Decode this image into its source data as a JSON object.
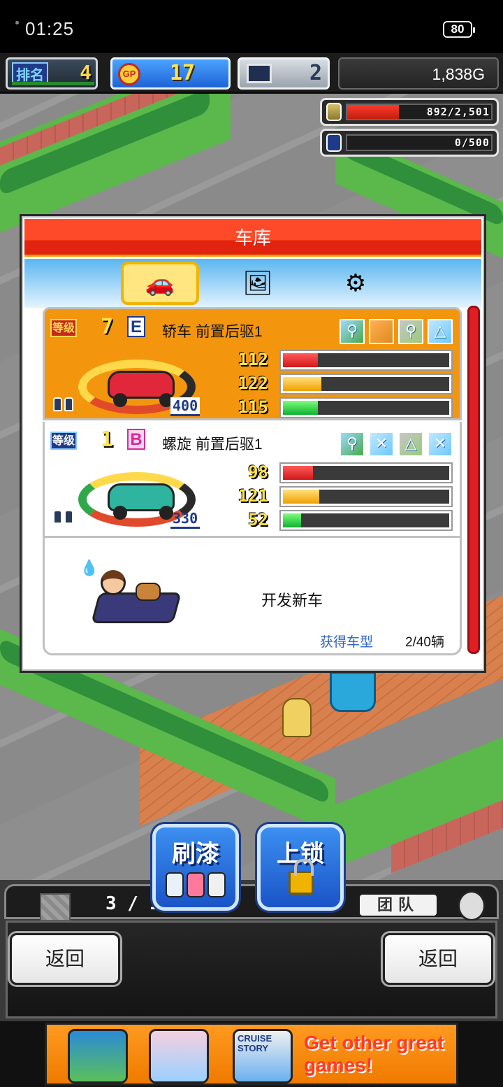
{
  "status_bar": {
    "time": "01:25",
    "battery": "80"
  },
  "hud": {
    "rank_label": "排名",
    "rank_value": "4",
    "gp_icon": "GP",
    "gp_value": "17",
    "pc_value": "2",
    "money": "1,838G"
  },
  "resources": {
    "coins": {
      "text": "892/2,501",
      "fill": 0.36,
      "icon": "coin-stack-icon"
    },
    "fuel": {
      "text": "0/500",
      "fill": 0.0,
      "icon": "fuel-can-icon"
    }
  },
  "garage": {
    "title": "车库",
    "tabs": [
      {
        "name": "car",
        "icon": "🚗",
        "active": true
      },
      {
        "name": "paint",
        "icon": "🖼",
        "active": false
      },
      {
        "name": "engine",
        "icon": "⚙",
        "active": false
      }
    ],
    "cars": [
      {
        "level_label": "等级",
        "level": "7",
        "grade": "E",
        "name": "轿车 前置后驱1",
        "parts": [
          "⚲",
          "",
          "⚲",
          "△"
        ],
        "odometer": "400",
        "stats": [
          {
            "value": "112",
            "fill": 0.21
          },
          {
            "value": "122",
            "fill": 0.23
          },
          {
            "value": "115",
            "fill": 0.21
          }
        ]
      },
      {
        "level_label": "等级",
        "level": "1",
        "grade": "B",
        "name": "螺旋 前置后驱1",
        "parts": [
          "⚲",
          "✕",
          "△",
          "✕"
        ],
        "odometer": "330",
        "stats": [
          {
            "value": "98",
            "fill": 0.18
          },
          {
            "value": "121",
            "fill": 0.22
          },
          {
            "value": "52",
            "fill": 0.11
          }
        ]
      }
    ],
    "develop": {
      "title": "开发新车",
      "link": "获得车型",
      "count": "2/40辆"
    }
  },
  "toolbar": {
    "count": "3 / 10",
    "team": "团队",
    "paint_label": "刷漆",
    "lock_label": "上锁",
    "back_left": "返回",
    "back_right": "返回"
  },
  "ad": {
    "thumb3_text": "CRUISE STORY",
    "text": "Get other great games!"
  },
  "colors": {
    "title_red": "#e0240f",
    "card_orange": "#f4950e",
    "accent_blue": "#1f63d6",
    "link_blue": "#2b63c4",
    "stat_red": "#d01818",
    "stat_yellow": "#f0a000",
    "stat_green": "#10b030"
  }
}
